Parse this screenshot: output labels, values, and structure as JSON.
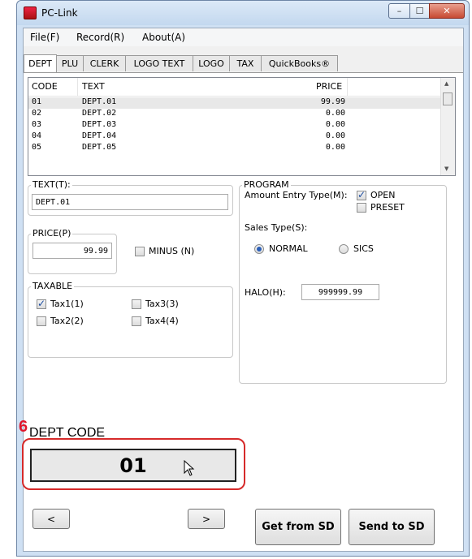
{
  "window": {
    "title": "PC-Link",
    "min_glyph": "–",
    "max_glyph": "☐",
    "close_glyph": "✕"
  },
  "menu": [
    {
      "label": "File(F)"
    },
    {
      "label": "Record(R)"
    },
    {
      "label": "About(A)"
    }
  ],
  "tabs": [
    {
      "label": "DEPT",
      "active": true
    },
    {
      "label": "PLU"
    },
    {
      "label": "CLERK"
    },
    {
      "label": "LOGO TEXT"
    },
    {
      "label": "LOGO"
    },
    {
      "label": "TAX"
    },
    {
      "label": "QuickBooks®"
    }
  ],
  "table": {
    "columns": [
      "CODE",
      "TEXT",
      "PRICE"
    ],
    "rows": [
      {
        "code": "01",
        "text": "DEPT.01",
        "price": "99.99",
        "selected": true
      },
      {
        "code": "02",
        "text": "DEPT.02",
        "price": "0.00"
      },
      {
        "code": "03",
        "text": "DEPT.03",
        "price": "0.00"
      },
      {
        "code": "04",
        "text": "DEPT.04",
        "price": "0.00"
      },
      {
        "code": "05",
        "text": "DEPT.05",
        "price": "0.00"
      }
    ]
  },
  "text_group": {
    "label": "TEXT(T):",
    "value": "DEPT.01"
  },
  "price_group": {
    "label": "PRICE(P)",
    "value": "99.99",
    "minus_label": "MINUS (N)",
    "minus_checked": false
  },
  "taxable": {
    "label": "TAXABLE",
    "items": [
      {
        "label": "Tax1(1)",
        "checked": true
      },
      {
        "label": "Tax2(2)",
        "checked": false
      },
      {
        "label": "Tax3(3)",
        "checked": false
      },
      {
        "label": "Tax4(4)",
        "checked": false
      }
    ]
  },
  "program": {
    "label": "PROGRAM",
    "amount_entry_label": "Amount Entry Type(M):",
    "open_label": "OPEN",
    "open_checked": true,
    "preset_label": "PRESET",
    "preset_checked": false,
    "sales_type_label": "Sales Type(S):",
    "normal_label": "NORMAL",
    "sics_label": "SICS",
    "selected_sales_type": "NORMAL",
    "halo_label": "HALO(H):",
    "halo_value": "999999.99"
  },
  "annotation": {
    "step_number": "6",
    "title": "DEPT CODE",
    "code": "01"
  },
  "nav": {
    "prev": "<",
    "next": ">"
  },
  "actions": {
    "get": "Get from SD",
    "send": "Send to SD"
  },
  "colors": {
    "callout": "#d62a2a",
    "step_number": "#e0162b"
  }
}
